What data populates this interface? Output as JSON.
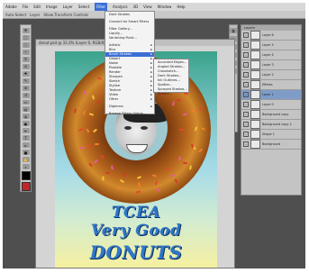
{
  "menubar": {
    "items": [
      "Adobe",
      "File",
      "Edit",
      "Image",
      "Layer",
      "Select",
      "Filter",
      "Analysis",
      "3D",
      "View",
      "Window",
      "Help"
    ],
    "active_index": 6
  },
  "optionsbar": {
    "items": [
      "Auto-Select",
      "Layer",
      "Show Transform Controls"
    ]
  },
  "document": {
    "title": "donut.psd @ 33.3% (Layer 0, RGB/8)"
  },
  "filter_menu": {
    "items": [
      {
        "label": "Dark Strokes",
        "kind": "item"
      },
      {
        "label": "",
        "kind": "sep"
      },
      {
        "label": "Convert for Smart Filters",
        "kind": "item"
      },
      {
        "label": "",
        "kind": "sep"
      },
      {
        "label": "Filter Gallery...",
        "kind": "item"
      },
      {
        "label": "Liquify...",
        "kind": "item"
      },
      {
        "label": "Vanishing Point...",
        "kind": "item"
      },
      {
        "label": "",
        "kind": "sep"
      },
      {
        "label": "Artistic",
        "kind": "sub"
      },
      {
        "label": "Blur",
        "kind": "sub"
      },
      {
        "label": "Brush Strokes",
        "kind": "sub",
        "highlight": true
      },
      {
        "label": "Distort",
        "kind": "sub"
      },
      {
        "label": "Noise",
        "kind": "sub"
      },
      {
        "label": "Pixelate",
        "kind": "sub"
      },
      {
        "label": "Render",
        "kind": "sub"
      },
      {
        "label": "Sharpen",
        "kind": "sub"
      },
      {
        "label": "Sketch",
        "kind": "sub"
      },
      {
        "label": "Stylize",
        "kind": "sub"
      },
      {
        "label": "Texture",
        "kind": "sub"
      },
      {
        "label": "Video",
        "kind": "sub"
      },
      {
        "label": "Other",
        "kind": "sub"
      },
      {
        "label": "",
        "kind": "sep"
      },
      {
        "label": "Digimarc",
        "kind": "sub"
      },
      {
        "label": "",
        "kind": "sep"
      },
      {
        "label": "Browse Filters Online...",
        "kind": "item"
      }
    ]
  },
  "brush_submenu": {
    "items": [
      "Accented Edges...",
      "Angled Strokes...",
      "Crosshatch...",
      "Dark Strokes...",
      "Ink Outlines...",
      "Spatter...",
      "Sprayed Strokes...",
      "Sumi-e..."
    ]
  },
  "layers_panel": {
    "header": "Layers",
    "layers": [
      {
        "name": "Layer 6",
        "selected": false
      },
      {
        "name": "Layer 5",
        "selected": false
      },
      {
        "name": "Layer 4",
        "selected": false
      },
      {
        "name": "Layer 3",
        "selected": false
      },
      {
        "name": "Layer 2",
        "selected": false
      },
      {
        "name": "Effects",
        "selected": false
      },
      {
        "name": "Layer 1",
        "selected": true
      },
      {
        "name": "Layer 0",
        "selected": false
      },
      {
        "name": "Background copy",
        "selected": false
      },
      {
        "name": "Background copy 2",
        "selected": false
      },
      {
        "name": "Shape 1",
        "selected": false
      },
      {
        "name": "Background",
        "selected": false
      }
    ]
  },
  "canvas": {
    "line1": "TCEA",
    "line2": "Very Good",
    "line3": "DONUTS"
  },
  "colors": {
    "accent": "#3b6fd6",
    "text_blue": "#2f77c9",
    "workspace": "#4f4f4f"
  }
}
